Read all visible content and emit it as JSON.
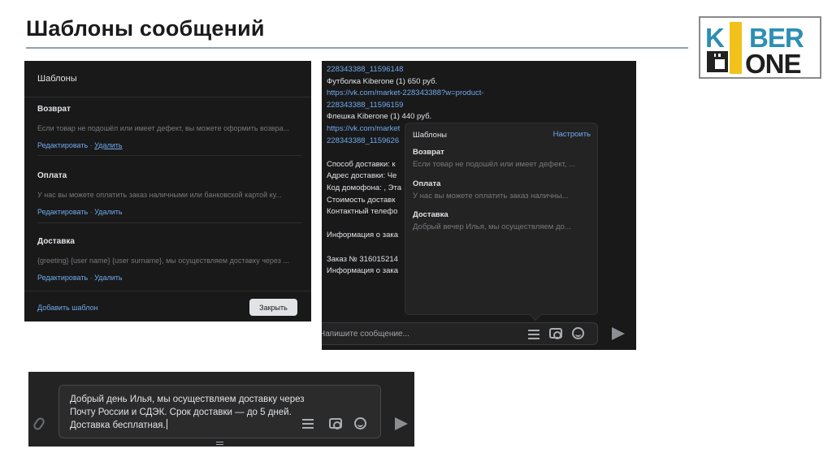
{
  "slide": {
    "title": "Шаблоны сообщений"
  },
  "logo": {
    "line1_k": "K",
    "line1_rest": "BER",
    "line2": "ONE",
    "colors": {
      "blue": "#2c8fb5",
      "yellow": "#f2c21a",
      "dark": "#1e1e1e"
    }
  },
  "templates_dialog": {
    "header": "Шаблоны",
    "items": [
      {
        "name": "Возврат",
        "desc": "Если товар не подошёл или имеет дефект, вы можете оформить возвра...",
        "edit": "Редактировать",
        "sep": " · ",
        "delete": "Удалить"
      },
      {
        "name": "Оплата",
        "desc": "У нас вы можете оплатить заказ наличными или банковской картой ку...",
        "edit": "Редактировать",
        "sep": " · ",
        "delete": "Удалить"
      },
      {
        "name": "Доставка",
        "desc": "{greeting} {user name} {user surname}, мы осуществляем доставку через ...",
        "edit": "Редактировать",
        "sep": " · ",
        "delete": "Удалить"
      }
    ],
    "add_label": "Добавить шаблон",
    "close_label": "Закрыть"
  },
  "chat": {
    "lines": [
      {
        "text": "228343388_11596148",
        "kind": "link"
      },
      {
        "text": "Футболка Kiberone (1) 650 руб.",
        "kind": "text"
      },
      {
        "text": "https://vk.com/market-228343388?w=product-",
        "kind": "link"
      },
      {
        "text": "228343388_11596159",
        "kind": "link"
      },
      {
        "text": "Флешка Kiberone (1) 440 руб.",
        "kind": "text"
      },
      {
        "text": "https://vk.com/market",
        "kind": "link"
      },
      {
        "text": "228343388_1159626",
        "kind": "link"
      },
      {
        "text": "",
        "kind": "gap"
      },
      {
        "text": "Способ доставки: к",
        "kind": "text"
      },
      {
        "text": "Адрес доставки: Че",
        "kind": "text"
      },
      {
        "text": "Код домофона: , Эта",
        "kind": "text"
      },
      {
        "text": "Стоимость доставк",
        "kind": "text"
      },
      {
        "text": "Контактный телефо",
        "kind": "text"
      },
      {
        "text": "",
        "kind": "gap"
      },
      {
        "text": "Информация о зака",
        "kind": "text"
      },
      {
        "text": "",
        "kind": "gap"
      },
      {
        "text": "Заказ № 316015214",
        "kind": "text"
      },
      {
        "text": "Информация о зака",
        "kind": "text"
      }
    ],
    "popup": {
      "header": "Шаблоны",
      "settings": "Настроить",
      "items": [
        {
          "name": "Возврат",
          "desc": "Если товар не подошёл или имеет дефект, ..."
        },
        {
          "name": "Оплата",
          "desc": "У нас вы можете оплатить заказ наличны..."
        },
        {
          "name": "Доставка",
          "desc": "Добрый вечер Илья, мы осуществляем до..."
        }
      ]
    },
    "composer_placeholder": "Напишите сообщение..."
  },
  "bottom_composer": {
    "message": "Добрый день Илья, мы осуществляем доставку через Почту России и СДЭК. Срок доставки — до 5 дней. Доставка бесплатная."
  },
  "icons": {
    "templates": "list-icon",
    "camera": "camera-icon",
    "emoji": "smile-icon",
    "send": "send-icon",
    "attach": "paperclip-icon"
  },
  "colors": {
    "panel_bg": "#19191a",
    "link": "#71aaeb",
    "text": "#e1e3e6",
    "muted": "#76787a"
  }
}
